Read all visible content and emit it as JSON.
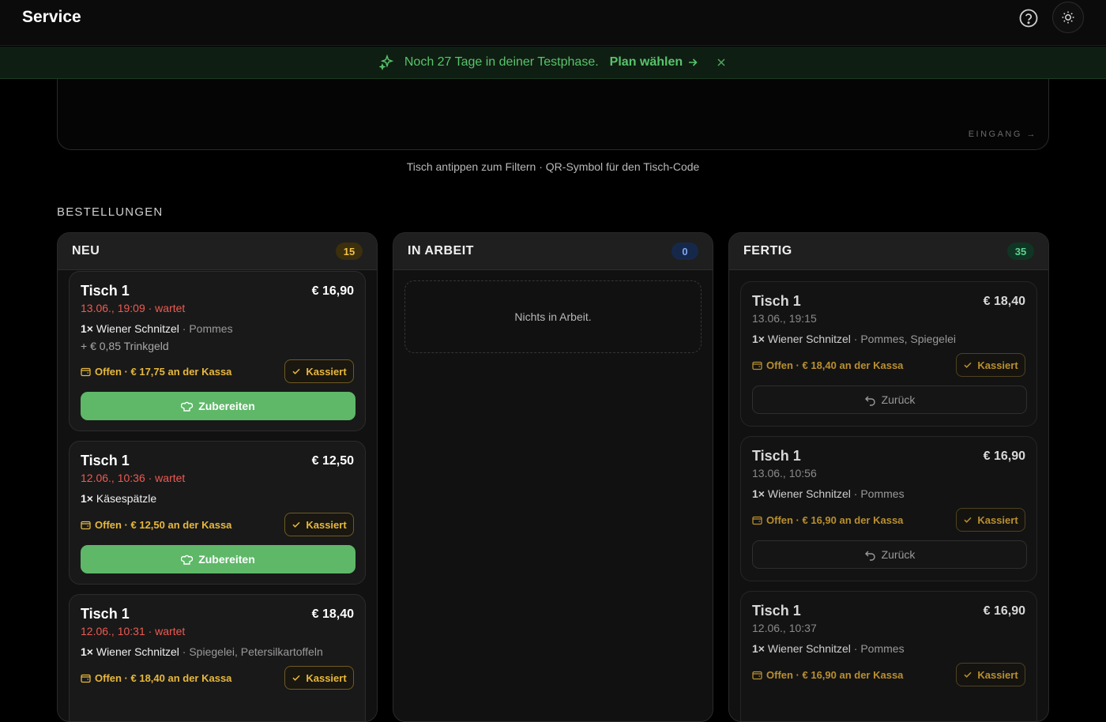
{
  "header": {
    "title": "Service",
    "help_icon": "help-circle-icon",
    "theme_icon": "sun-icon"
  },
  "banner": {
    "text": "Noch 27 Tage in deiner Testphase.",
    "link": "Plan wählen",
    "accent": "#57c46b"
  },
  "tables": {
    "entrance_label": "EINGANG →",
    "hint": "Tisch antippen zum Filtern · QR-Symbol für den Tisch-Code"
  },
  "orders_title": "BESTELLUNGEN",
  "columns": {
    "new": {
      "title": "NEU",
      "count": "15",
      "cards": [
        {
          "title": "Tisch 1",
          "price": "€ 16,90",
          "meta": "13.06., 19:09 · wartet",
          "qty": "1×",
          "item": "Wiener Schnitzel",
          "sides": " · Pommes",
          "tip": "+ € 0,85 Trinkgeld",
          "pay": "Offen · € 17,75 an der Kassa",
          "kassiert": "Kassiert",
          "action": "Zubereiten"
        },
        {
          "title": "Tisch 1",
          "price": "€ 12,50",
          "meta": "12.06., 10:36 · wartet",
          "qty": "1×",
          "item": "Käsespätzle",
          "sides": "",
          "pay": "Offen · € 12,50 an der Kassa",
          "kassiert": "Kassiert",
          "action": "Zubereiten"
        },
        {
          "title": "Tisch 1",
          "price": "€ 18,40",
          "meta": "12.06., 10:31 · wartet",
          "qty": "1×",
          "item": "Wiener Schnitzel",
          "sides": " · Spiegelei, Petersilkartoffeln",
          "pay": "Offen · € 18,40 an der Kassa",
          "kassiert": "Kassiert"
        }
      ]
    },
    "in_progress": {
      "title": "IN ARBEIT",
      "count": "0",
      "empty": "Nichts in Arbeit."
    },
    "done": {
      "title": "FERTIG",
      "count": "35",
      "cards": [
        {
          "title": "Tisch 1",
          "price": "€ 18,40",
          "meta": "13.06., 19:15",
          "qty": "1×",
          "item": "Wiener Schnitzel",
          "sides": " · Pommes, Spiegelei",
          "pay": "Offen · € 18,40 an der Kassa",
          "kassiert": "Kassiert",
          "back": "Zurück"
        },
        {
          "title": "Tisch 1",
          "price": "€ 16,90",
          "meta": "13.06., 10:56",
          "qty": "1×",
          "item": "Wiener Schnitzel",
          "sides": " · Pommes",
          "pay": "Offen · € 16,90 an der Kassa",
          "kassiert": "Kassiert",
          "back": "Zurück"
        },
        {
          "title": "Tisch 1",
          "price": "€ 16,90",
          "meta": "12.06., 10:37",
          "qty": "1×",
          "item": "Wiener Schnitzel",
          "sides": " · Pommes",
          "pay": "Offen · € 16,90 an der Kassa",
          "kassiert": "Kassiert"
        }
      ]
    }
  }
}
